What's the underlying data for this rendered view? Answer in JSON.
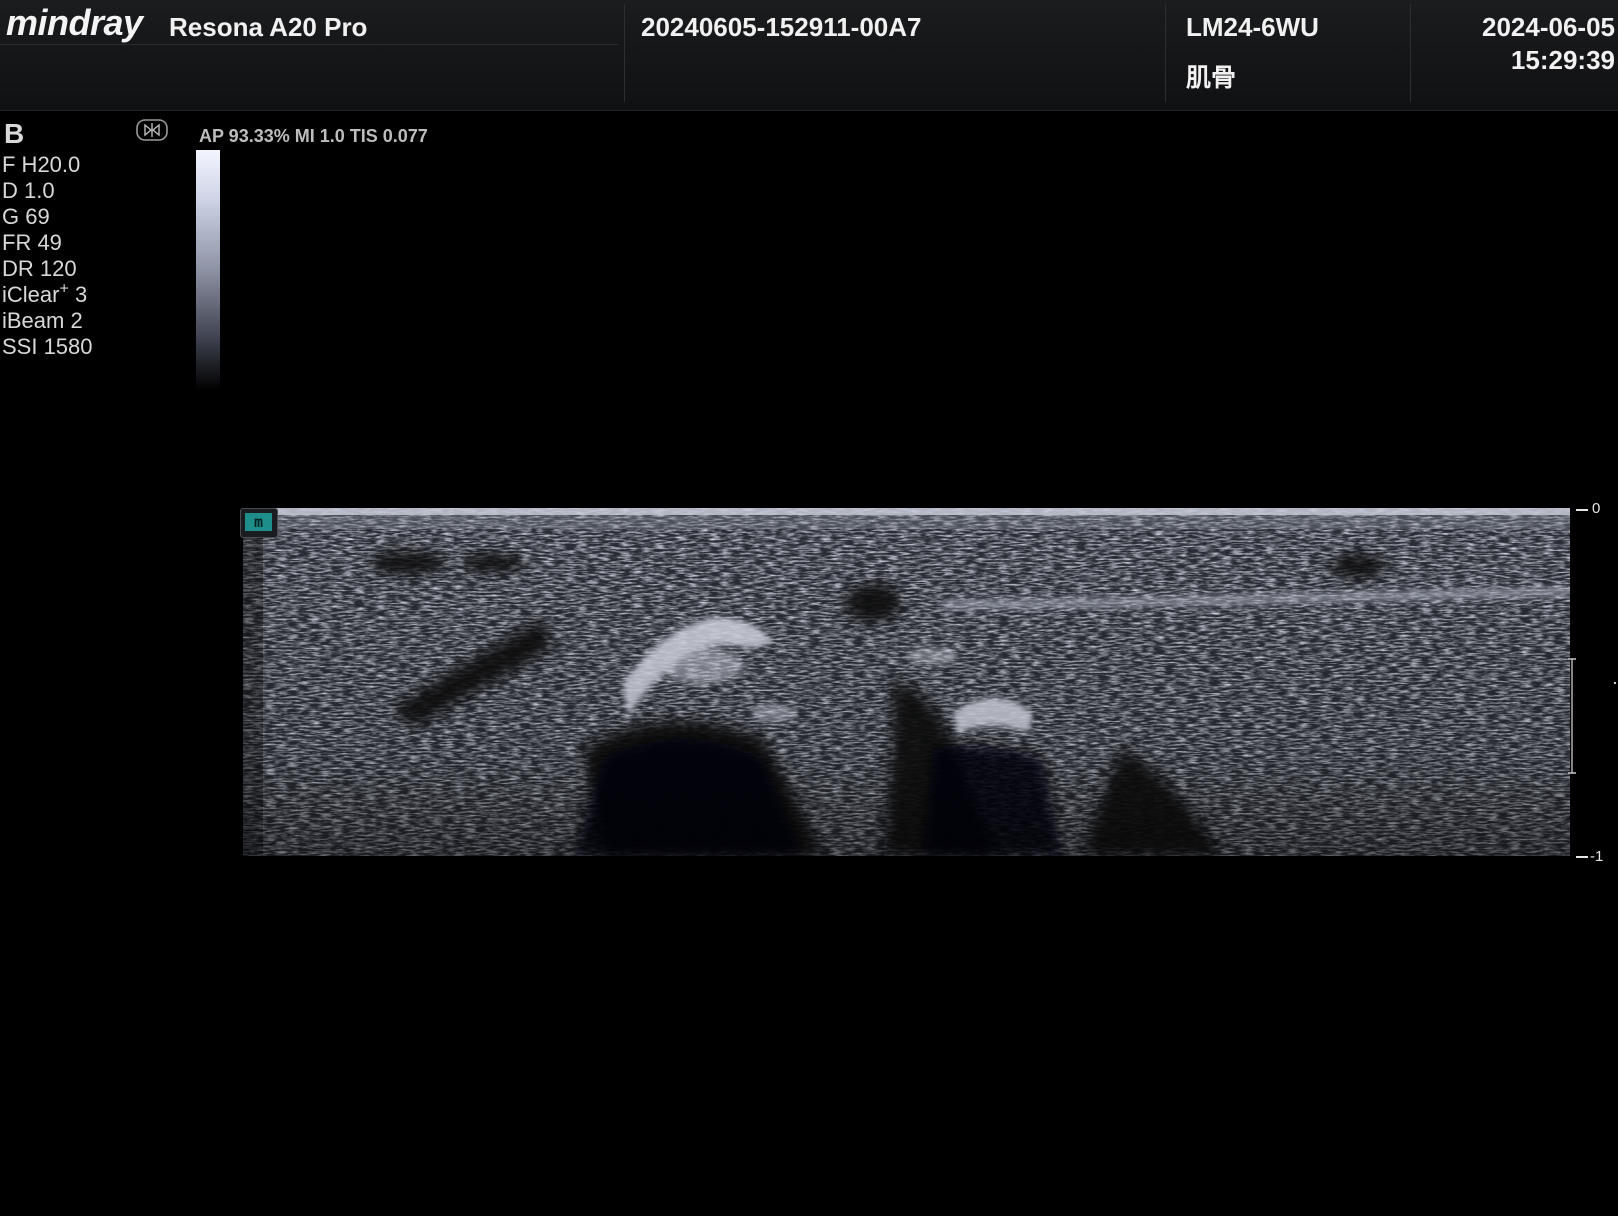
{
  "header": {
    "logo": "mindray",
    "model": "Resona A20 Pro",
    "exam_id": "20240605-152911-00A7",
    "probe": "LM24-6WU",
    "preset": "肌骨",
    "date": "2024-06-05",
    "time": "15:29:39"
  },
  "imaging": {
    "mode": "B",
    "params": [
      "F H20.0",
      "D 1.0",
      "G 69",
      "FR 49",
      "DR 120",
      "iBeam 2",
      "SSI 1580"
    ],
    "iclear_label": "iClear",
    "iclear_sup": "+",
    "iclear_value": "3",
    "acoustic": "AP 93.33%  MI 1.0 TIS 0.077"
  },
  "image": {
    "probe_marker": "m",
    "depth_top": "0",
    "depth_bottom": "1"
  },
  "colors": {
    "marker": "#1e8e8a",
    "background": "#000000"
  }
}
